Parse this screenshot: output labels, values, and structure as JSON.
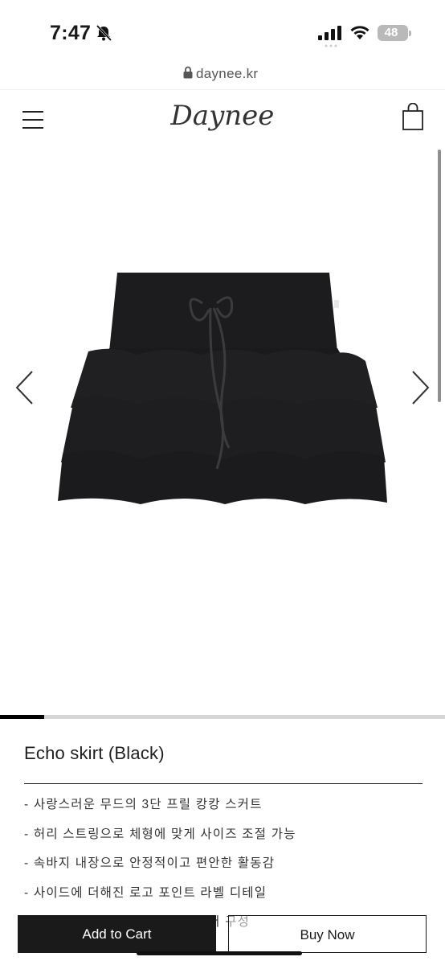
{
  "status_bar": {
    "time": "7:47",
    "battery": "48",
    "icons": [
      "bell-slash-icon",
      "cellular-signal-icon",
      "wifi-icon",
      "battery-icon"
    ]
  },
  "browser": {
    "url": "daynee.kr",
    "icon": "lock-icon"
  },
  "header": {
    "logo": "Daynee",
    "menu_icon": "hamburger-menu-icon",
    "cart_icon": "shopping-bag-icon"
  },
  "gallery": {
    "image": "black-tiered-ruffle-skirt",
    "prev_icon": "chevron-left-icon",
    "next_icon": "chevron-right-icon",
    "progress": 0.1
  },
  "product": {
    "title": "Echo skirt (Black)",
    "description": [
      "- 사랑스러운 무드의 3단 프릴 캉캉 스커트",
      "- 허리 스트링으로 체형에 맞게 사이즈 조절 가능",
      "- 속바지 내장으로 안정적이고 편안한 활동감",
      "- 사이드에 더해진 로고 포인트 라벨 디테일",
      "- 데일리로 즐기기 좋은 3가지 컬러 구성"
    ]
  },
  "actions": {
    "add_to_cart": "Add to Cart",
    "buy_now": "Buy Now"
  },
  "colors": {
    "primary": "#1a1a1a",
    "background": "#ffffff",
    "progress_track": "#d6d6d6"
  }
}
